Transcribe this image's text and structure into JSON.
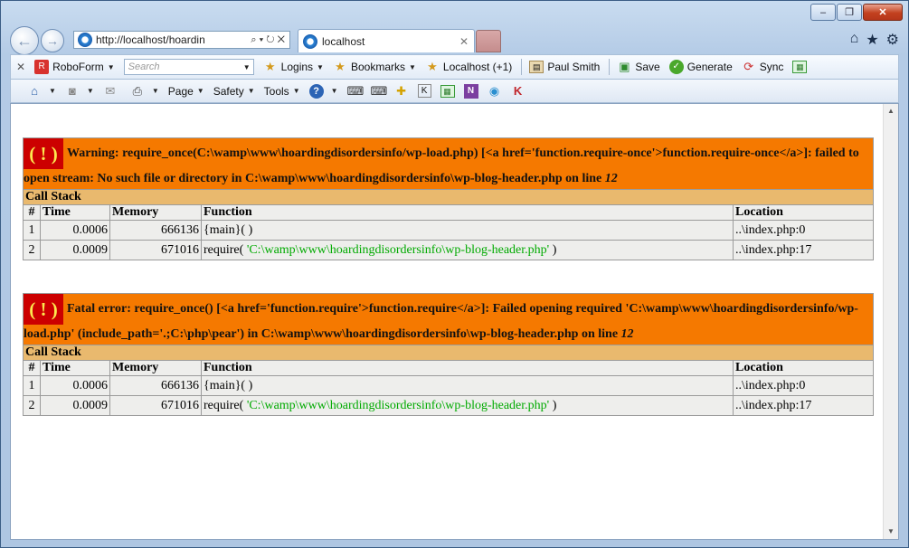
{
  "window": {
    "minimize": "–",
    "maximize": "❐",
    "close": "✕"
  },
  "nav": {
    "back": "←",
    "forward": "→"
  },
  "address": {
    "url": "http://localhost/hoardin",
    "controls": "⌕ ▾ ↻ ✕"
  },
  "tab": {
    "title": "localhost",
    "close": "✕"
  },
  "right_tools": {
    "home": "⌂",
    "favorites": "★",
    "settings": "⚙"
  },
  "toolbar1": {
    "close": "✕",
    "roboform": "RoboForm",
    "search_placeholder": "Search",
    "logins": "Logins",
    "bookmarks": "Bookmarks",
    "localhost": "Localhost (+1)",
    "user": "Paul Smith",
    "save": "Save",
    "generate": "Generate",
    "sync": "Sync"
  },
  "toolbar2": {
    "page": "Page",
    "safety": "Safety",
    "tools": "Tools",
    "help": "?"
  },
  "errors": [
    {
      "icon": "( ! )",
      "message": "Warning: require_once(C:\\wamp\\www\\hoardingdisordersinfo/wp-load.php) [<a href='function.require-once'>function.require-once</a>]: failed to open stream: No such file or directory in C:\\wamp\\www\\hoardingdisordersinfo\\wp-blog-header.php on line ",
      "line": "12",
      "call_stack_label": "Call Stack",
      "headers": [
        "#",
        "Time",
        "Memory",
        "Function",
        "Location"
      ],
      "rows": [
        {
          "num": "1",
          "time": "0.0006",
          "memory": "666136",
          "func": "{main}( )",
          "arg": "",
          "func_end": "",
          "location": "..\\index.php:0"
        },
        {
          "num": "2",
          "time": "0.0009",
          "memory": "671016",
          "func": "require( ",
          "arg": "'C:\\wamp\\www\\hoardingdisordersinfo\\wp-blog-header.php'",
          "func_end": " )",
          "location": "..\\index.php:17"
        }
      ]
    },
    {
      "icon": "( ! )",
      "message": "Fatal error: require_once() [<a href='function.require'>function.require</a>]: Failed opening required 'C:\\wamp\\www\\hoardingdisordersinfo/wp-load.php' (include_path='.;C:\\php\\pear') in C:\\wamp\\www\\hoardingdisordersinfo\\wp-blog-header.php on line ",
      "line": "12",
      "call_stack_label": "Call Stack",
      "headers": [
        "#",
        "Time",
        "Memory",
        "Function",
        "Location"
      ],
      "rows": [
        {
          "num": "1",
          "time": "0.0006",
          "memory": "666136",
          "func": "{main}( )",
          "arg": "",
          "func_end": "",
          "location": "..\\index.php:0"
        },
        {
          "num": "2",
          "time": "0.0009",
          "memory": "671016",
          "func": "require( ",
          "arg": "'C:\\wamp\\www\\hoardingdisordersinfo\\wp-blog-header.php'",
          "func_end": " )",
          "location": "..\\index.php:17"
        }
      ]
    }
  ]
}
